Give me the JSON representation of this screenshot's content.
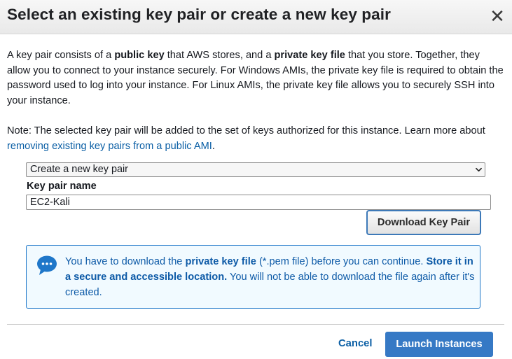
{
  "dialog": {
    "title": "Select an existing key pair or create a new key pair",
    "close_glyph": "✕"
  },
  "intro": {
    "t1": "A key pair consists of a ",
    "b1": "public key",
    "t2": " that AWS stores, and a ",
    "b2": "private key file",
    "t3": " that you store. Together, they allow you to connect to your instance securely. For Windows AMIs, the private key file is required to obtain the password used to log into your instance. For Linux AMIs, the private key file allows you to securely SSH into your instance."
  },
  "note": {
    "text": "Note: The selected key pair will be added to the set of keys authorized for this instance. Learn more about ",
    "link": "removing existing key pairs from a public AMI",
    "end": "."
  },
  "key_pair_select": {
    "selected": "Create a new key pair"
  },
  "key_pair_name": {
    "label": "Key pair name",
    "value": "EC2-Kali"
  },
  "download_button": {
    "label": "Download Key Pair"
  },
  "info_alert": {
    "t1": "You have to download the ",
    "b1": "private key file",
    "t2": " (*.pem file) before you can continue. ",
    "b2": "Store it in a secure and accessible location.",
    "t3": " You will not be able to download the file again after it's created."
  },
  "footer": {
    "cancel_label": "Cancel",
    "launch_label": "Launch Instances"
  },
  "colors": {
    "accent": "#3679c5",
    "link": "#0b5fa5",
    "info_border": "#1f77c9",
    "info_bg": "#f1faff",
    "info_text": "#0d5aa7"
  }
}
